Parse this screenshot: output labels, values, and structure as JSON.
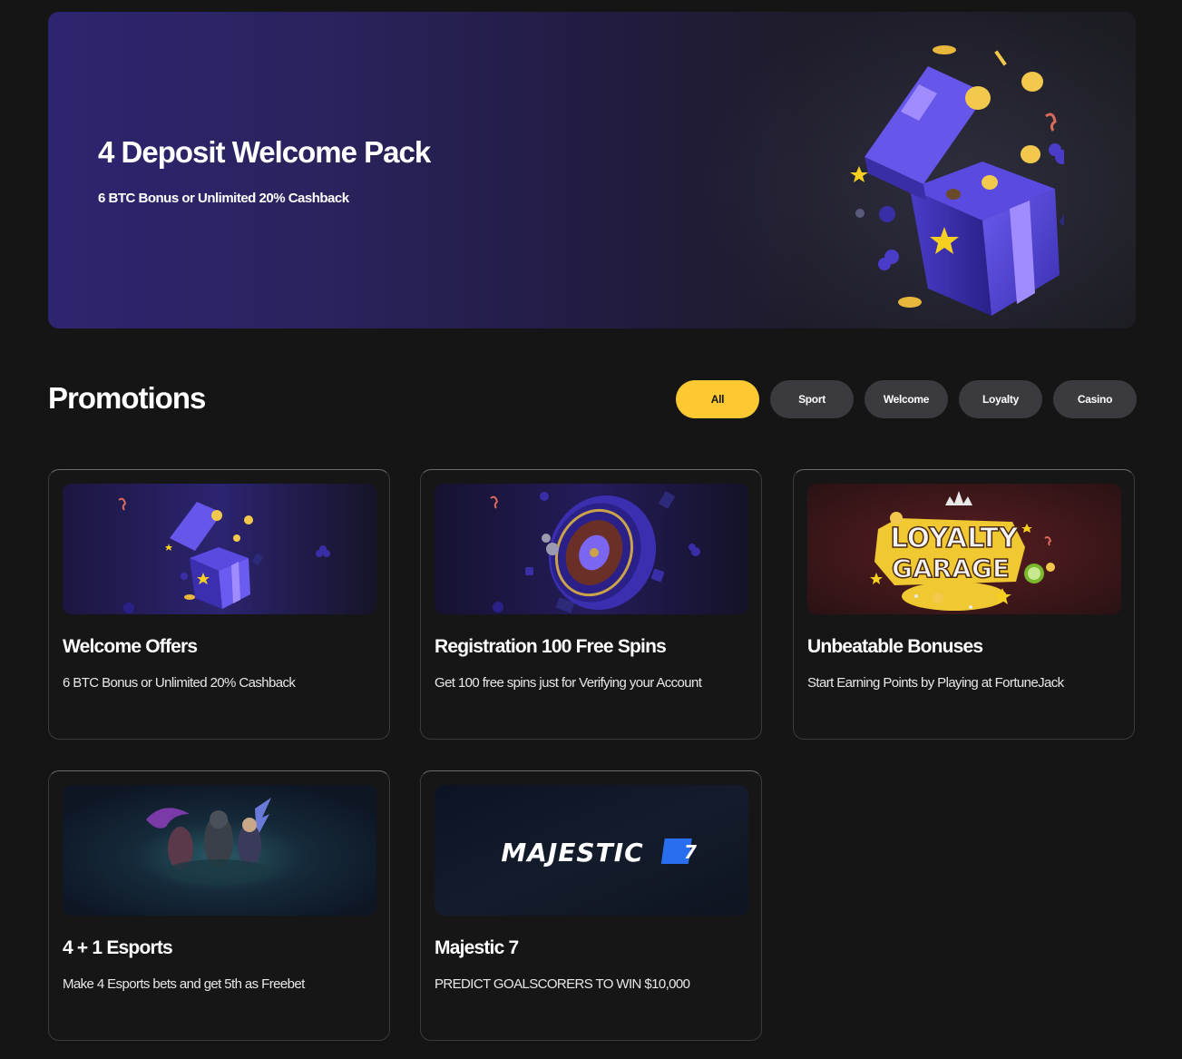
{
  "hero": {
    "title": "4 Deposit Welcome Pack",
    "subtitle": "6 BTC Bonus or Unlimited 20% Cashback",
    "image_icon": "gift-box-icon"
  },
  "promotions": {
    "title": "Promotions",
    "filters": [
      {
        "label": "All",
        "active": true
      },
      {
        "label": "Sport",
        "active": false
      },
      {
        "label": "Welcome",
        "active": false
      },
      {
        "label": "Loyalty",
        "active": false
      },
      {
        "label": "Casino",
        "active": false
      }
    ],
    "cards": [
      {
        "title": "Welcome Offers",
        "description": "6 BTC Bonus or Unlimited 20% Cashback",
        "image_icon": "gift-box-icon"
      },
      {
        "title": "Registration 100 Free Spins",
        "description": "Get 100 free spins just for Verifying your Account",
        "image_icon": "roulette-wheel-icon"
      },
      {
        "title": "Unbeatable Bonuses",
        "description": "Start Earning Points by Playing at FortuneJack",
        "image_text_line1": "LOYALTY",
        "image_text_line2": "GARAGE"
      },
      {
        "title": "4 + 1 Esports",
        "description": "Make 4 Esports bets and get 5th as Freebet",
        "image_icon": "esports-characters-icon"
      },
      {
        "title": "Majestic 7",
        "description": "PREDICT GOALSCORERS TO WIN $10,000",
        "image_text": "MAJESTIC",
        "image_badge": "7"
      }
    ]
  },
  "colors": {
    "background": "#151515",
    "accent": "#fcc932",
    "filter_inactive": "#3a3a3f",
    "hero_purple": "#2d2570"
  }
}
